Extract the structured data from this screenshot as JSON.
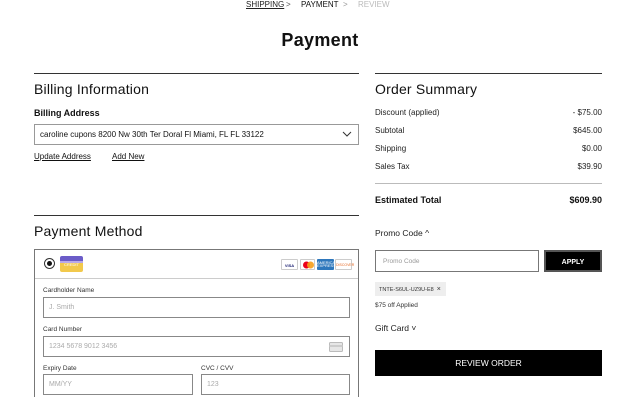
{
  "breadcrumb": {
    "steps": [
      "SHIPPING",
      "PAYMENT",
      "REVIEW"
    ],
    "separator": ">"
  },
  "page_title": "Payment",
  "billing": {
    "heading": "Billing Information",
    "address_label": "Billing Address",
    "selected_address": "caroline cupons 8200 Nw 30th Ter Doral Fl Miami, FL FL 33122",
    "update_link": "Update Address",
    "add_link": "Add New"
  },
  "payment_method": {
    "heading": "Payment Method",
    "card_icon_label": "CREDIT",
    "brands": [
      {
        "name": "VISA",
        "bg": "#ffffff",
        "fg": "#1a1f71"
      },
      {
        "name": "mc",
        "bg": "#ffffff",
        "fg": "#eb001b"
      },
      {
        "name": "AMERICAN EXPRESS",
        "bg": "#2e77bc",
        "fg": "#ffffff"
      },
      {
        "name": "DISCOVER",
        "bg": "#ffffff",
        "fg": "#e66a25"
      }
    ],
    "cardholder_label": "Cardholder Name",
    "cardholder_placeholder": "J. Smith",
    "card_number_label": "Card Number",
    "card_number_placeholder": "1234 5678 9012 3456",
    "expiry_label": "Expiry Date",
    "expiry_placeholder": "MM/YY",
    "cvc_label": "CVC / CVV",
    "cvc_placeholder": "123"
  },
  "order_summary": {
    "heading": "Order Summary",
    "rows": [
      {
        "label": "Discount (applied)",
        "value": "- $75.00"
      },
      {
        "label": "Subtotal",
        "value": "$645.00"
      },
      {
        "label": "Shipping",
        "value": "$0.00"
      },
      {
        "label": "Sales Tax",
        "value": "$39.90"
      }
    ],
    "total_label": "Estimated Total",
    "total_value": "$609.90",
    "promo_toggle": "Promo Code ^",
    "promo_placeholder": "Promo Code",
    "apply_label": "APPLY",
    "applied_code": "TNTE-S6UL-UZ9U-E8",
    "applied_note": "$75 off Applied",
    "gift_toggle": "Gift Card ˅",
    "review_button": "REVIEW ORDER"
  }
}
